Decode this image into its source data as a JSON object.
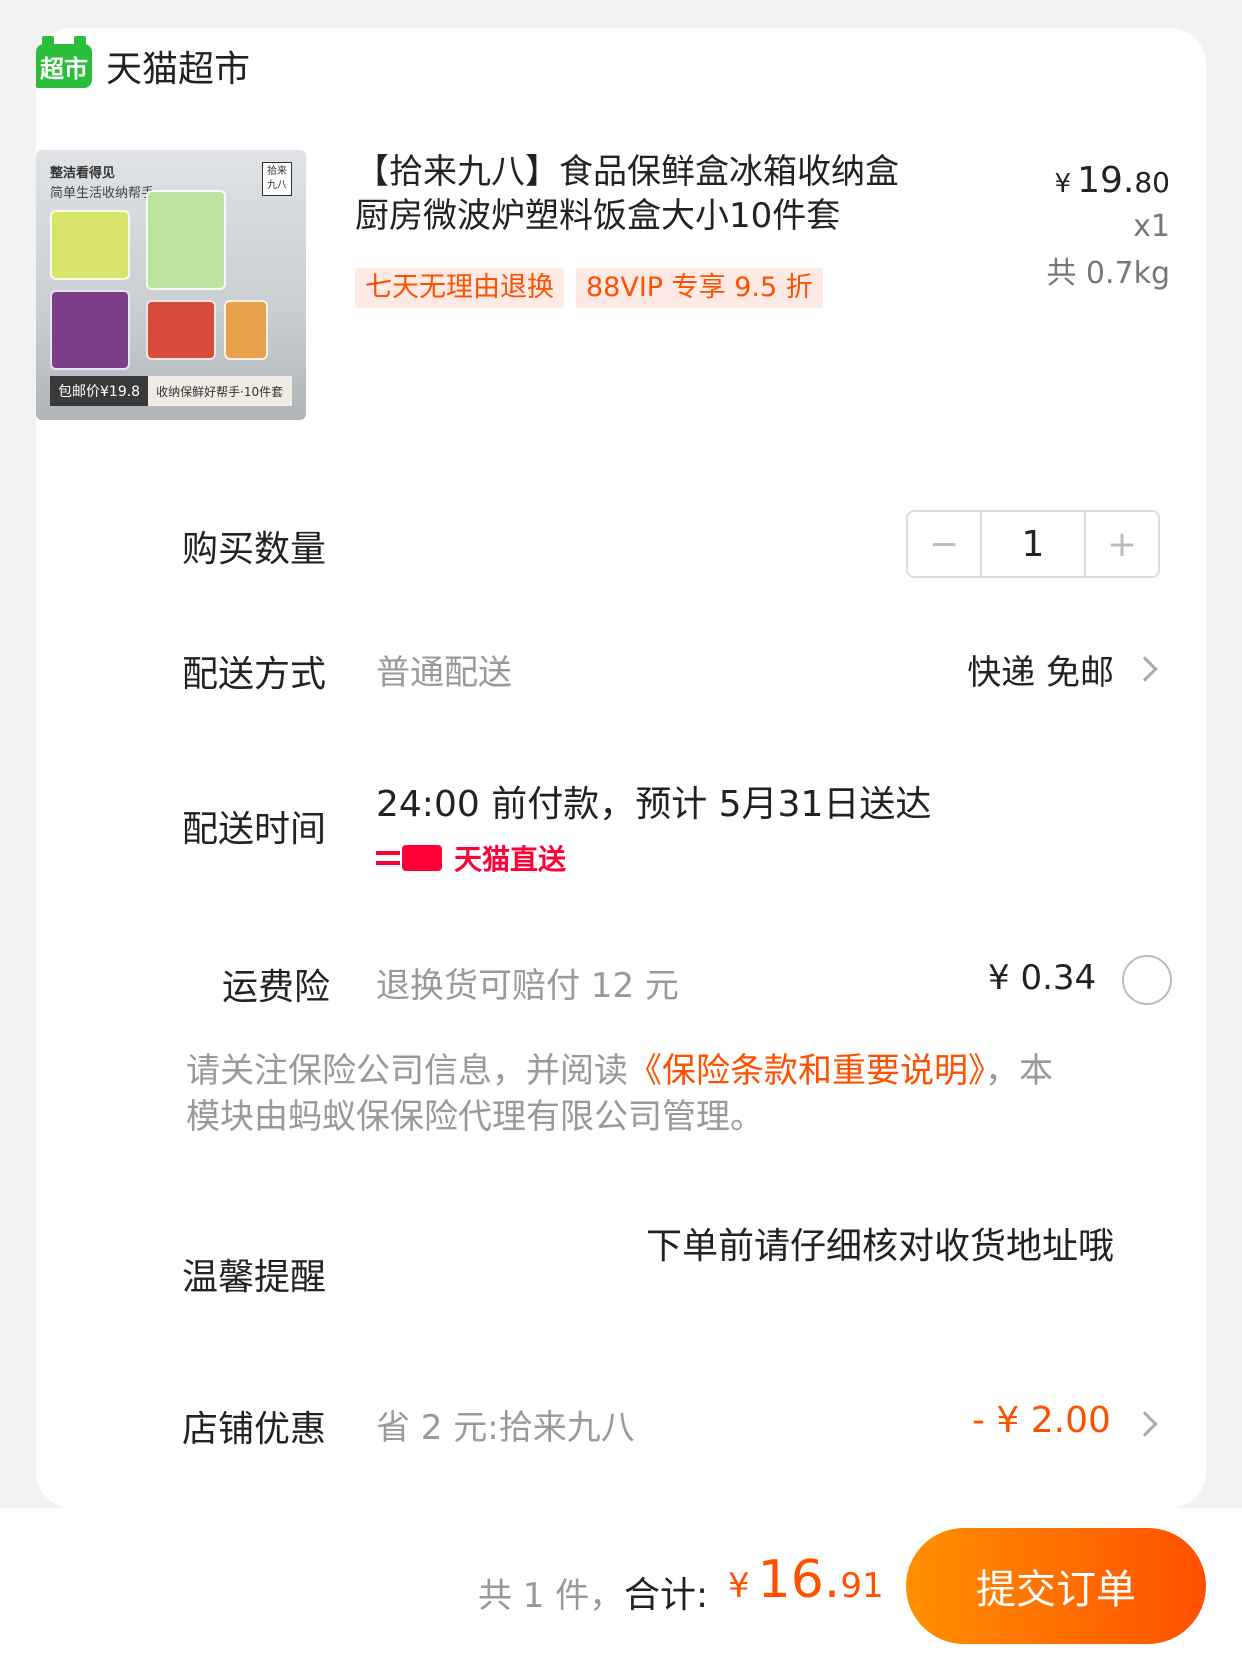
{
  "store": {
    "logo_text": "超市",
    "name": "天猫超市"
  },
  "product": {
    "image_caption1": "整洁看得见",
    "image_caption2": "简单生活收纳帮手",
    "image_brand": "拾来九八",
    "image_tag_price": "包邮价¥19.8",
    "image_tag_text": "收纳保鲜好帮手·10件套",
    "title": "【拾来九八】食品保鲜盒冰箱收纳盒厨房微波炉塑料饭盒大小10件套",
    "tags": [
      "七天无理由退换",
      "88VIP 专享 9.5 折"
    ],
    "price_currency": "¥",
    "price_int": "19.",
    "price_dec": "80",
    "quantity": "x1",
    "weight": "共 0.7kg"
  },
  "purchase_qty": {
    "label": "购买数量",
    "minus": "−",
    "value": "1",
    "plus": "+"
  },
  "shipping_method": {
    "label": "配送方式",
    "value": "普通配送",
    "right": "快递 免邮"
  },
  "delivery_time": {
    "label": "配送时间",
    "value": "24:00 前付款，预计 5月31日送达",
    "badge": "天猫直送"
  },
  "shipping_insurance": {
    "label": "运费险",
    "value": "退换货可赔付 12 元",
    "price": "¥ 0.34"
  },
  "insurance_notice": {
    "pre": "请关注保险公司信息，并阅读",
    "link": "《保险条款和重要说明》",
    "post": "，本模块由蚂蚁保保险代理有限公司管理。"
  },
  "reminder": {
    "label": "温馨提醒",
    "text": "下单前请仔细核对收货地址哦"
  },
  "store_discount": {
    "label": "店铺优惠",
    "value": "省 2 元:拾来九八",
    "amount": "- ¥ 2.00"
  },
  "footer": {
    "count": "共 1 件，",
    "total_label": "合计:",
    "total_currency": "¥",
    "total_int": "16.",
    "total_dec": "91",
    "submit": "提交订单"
  },
  "colors": {
    "accent": "#ff5000",
    "tmall_red": "#ff0036",
    "chaoshi_green": "#2bbd3b"
  }
}
